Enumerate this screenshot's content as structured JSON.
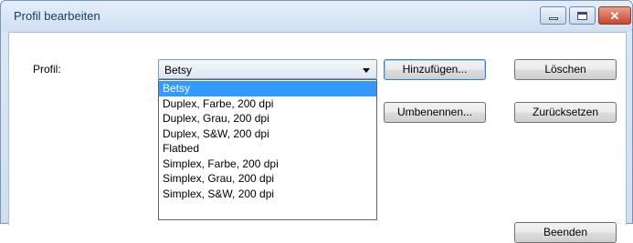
{
  "window": {
    "title": "Profil bearbeiten"
  },
  "form": {
    "profile_label": "Profil:",
    "profile_selected": "Betsy",
    "profile_options": [
      "Betsy",
      "Duplex, Farbe, 200 dpi",
      "Duplex, Grau, 200 dpi",
      "Duplex, S&W, 200 dpi",
      "Flatbed",
      "Simplex, Farbe, 200 dpi",
      "Simplex, Grau, 200 dpi",
      "Simplex, S&W, 200 dpi"
    ]
  },
  "buttons": {
    "add": "Hinzufügen...",
    "delete": "Löschen",
    "rename": "Umbenennen...",
    "reset": "Zurücksetzen",
    "exit": "Beenden"
  }
}
